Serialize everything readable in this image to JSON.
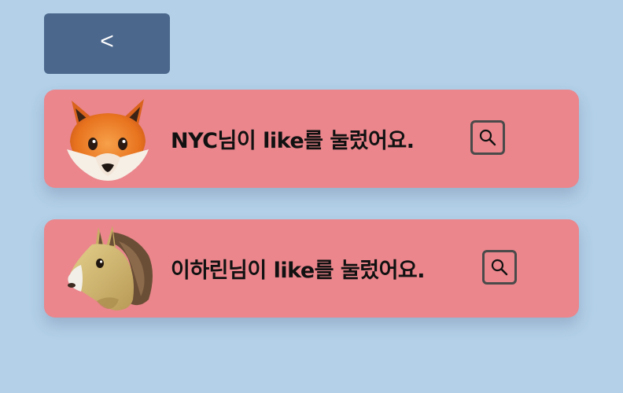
{
  "back_button": {
    "label": "<"
  },
  "notifications": [
    {
      "avatar_icon": "fox-face-icon",
      "message": "NYC님이 like를 눌렀어요.",
      "action_icon": "search-icon"
    },
    {
      "avatar_icon": "horse-face-icon",
      "message": "이하린님이 like를 눌렀어요.",
      "action_icon": "search-icon"
    }
  ],
  "colors": {
    "background": "#b3d0e8",
    "back_button": "#4b678c",
    "card": "#ea868c"
  }
}
